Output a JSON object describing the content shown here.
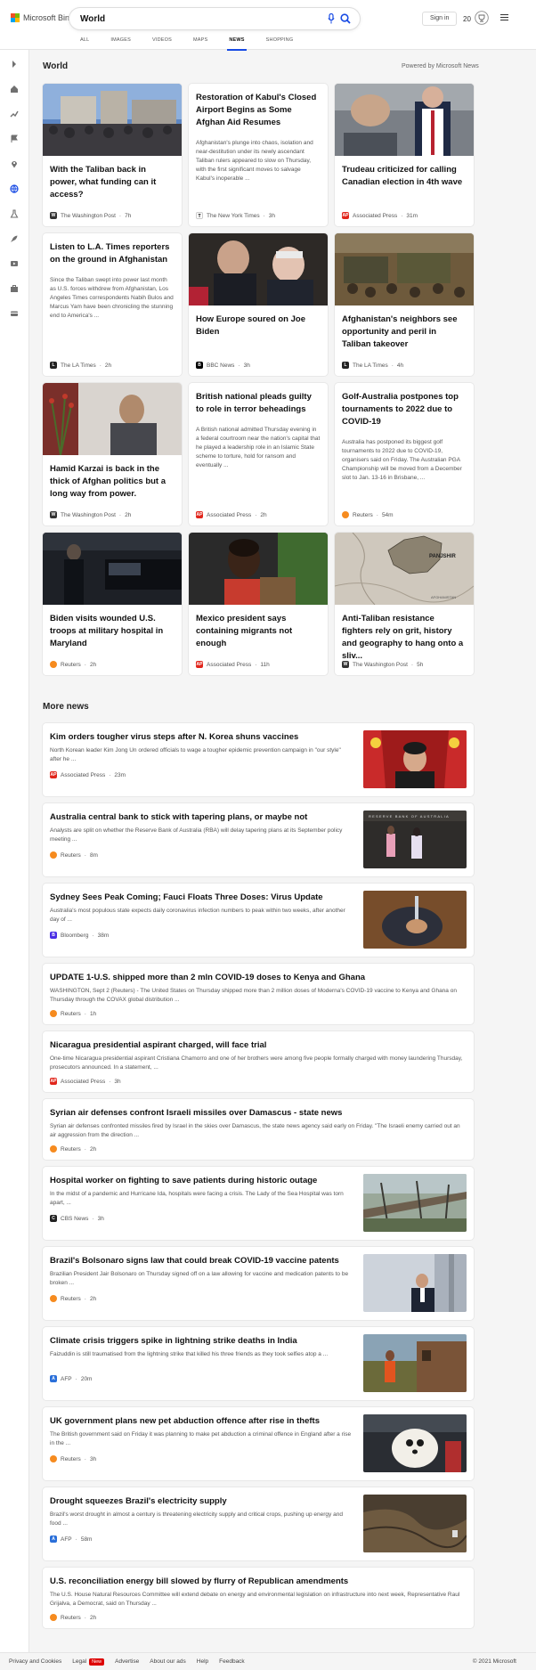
{
  "header": {
    "logo_text": "Microsoft Bing",
    "search_value": "World",
    "signin_label": "Sign in",
    "rewards_points": "20"
  },
  "scopes": [
    "ALL",
    "IMAGES",
    "VIDEOS",
    "MAPS",
    "NEWS",
    "SHOPPING"
  ],
  "active_scope": "NEWS",
  "section": {
    "title": "World",
    "powered_by": "Powered by Microsoft News"
  },
  "cards": [
    {
      "title": "With the Taliban back in power, what funding can it access?",
      "snippet": "",
      "source": "The Washington Post",
      "time": "7h"
    },
    {
      "title": "Restoration of Kabul's Closed Airport Begins as Some Afghan Aid Resumes",
      "snippet": "Afghanistan's plunge into chaos, isolation and near-destitution under its newly ascendant Taliban rulers appeared to slow on Thursday, with the first significant moves to salvage Kabul's inoperable ...",
      "source": "The New York Times",
      "time": "3h"
    },
    {
      "title": "Trudeau criticized for calling Canadian election in 4th wave",
      "snippet": "",
      "source": "Associated Press",
      "time": "31m"
    },
    {
      "title": "Listen to L.A. Times reporters on the ground in Afghanistan",
      "snippet": "Since the Taliban swept into power last month as U.S. forces withdrew from Afghanistan, Los Angeles Times correspondents Nabih Bulos and Marcus Yam have been chronicling the stunning end to America's ...",
      "source": "The LA Times",
      "time": "2h"
    },
    {
      "title": "How Europe soured on Joe Biden",
      "snippet": "",
      "source": "BBC News",
      "time": "3h"
    },
    {
      "title": "Afghanistan's neighbors see opportunity and peril in Taliban takeover",
      "snippet": "",
      "source": "The LA Times",
      "time": "4h"
    },
    {
      "title": "Hamid Karzai is back in the thick of Afghan politics but a long way from power.",
      "snippet": "",
      "source": "The Washington Post",
      "time": "2h"
    },
    {
      "title": "British national pleads guilty to role in terror beheadings",
      "snippet": "A British national admitted Thursday evening in a federal courtroom near the nation's capital that he played a leadership role in an Islamic State scheme to torture, hold for ransom and eventually ...",
      "source": "Associated Press",
      "time": "2h"
    },
    {
      "title": "Golf-Australia postpones top tournaments to 2022 due to COVID-19",
      "snippet": "Australia has postponed its biggest golf tournaments to 2022 due to COVID-19, organisers said on Friday. The Australian PGA Championship will be moved from a December slot to Jan. 13-16 in Brisbane, ...",
      "source": "Reuters",
      "time": "54m"
    },
    {
      "title": "Biden visits wounded U.S. troops at military hospital in Maryland",
      "snippet": "",
      "source": "Reuters",
      "time": "2h"
    },
    {
      "title": "Mexico president says containing migrants not enough",
      "snippet": "",
      "source": "Associated Press",
      "time": "11h"
    },
    {
      "title": "Anti-Taliban resistance fighters rely on grit, history and geography to hang onto a sliv...",
      "snippet": "",
      "source": "The Washington Post",
      "time": "5h"
    }
  ],
  "map_labels": {
    "region": "PANJSHIR",
    "country": "AFGHANISTAN"
  },
  "more_news": {
    "title": "More news",
    "items": [
      {
        "title": "Kim orders tougher virus steps after N. Korea shuns vaccines",
        "snippet": "North Korean leader Kim Jong Un ordered officials to wage a tougher epidemic prevention campaign in \"our style\" after he ...",
        "source": "Associated Press",
        "time": "23m"
      },
      {
        "title": "Australia central bank to stick with tapering plans, or maybe not",
        "snippet": "Analysts are split on whether the Reserve Bank of Australia (RBA) will delay tapering plans at its September policy meeting ...",
        "source": "Reuters",
        "time": "8m",
        "image_text": "RESERVE BANK OF AUSTRALIA"
      },
      {
        "title": "Sydney Sees Peak Coming; Fauci Floats Three Doses: Virus Update",
        "snippet": "Australia's most populous state expects daily coronavirus infection numbers to peak within two weeks, after another day of ...",
        "source": "Bloomberg",
        "time": "38m"
      },
      {
        "title": "UPDATE 1-U.S. shipped more than 2 mln COVID-19 doses to Kenya and Ghana",
        "snippet": "WASHINGTON, Sept 2 (Reuters) - The United States on Thursday shipped more than 2 million doses of Moderna's COVID-19 vaccine to Kenya and Ghana on Thursday through the COVAX global distribution ...",
        "source": "Reuters",
        "time": "1h"
      },
      {
        "title": "Nicaragua presidential aspirant charged, will face trial",
        "snippet": "One-time Nicaragua presidential aspirant Cristiana Chamorro and one of her brothers were among five people formally charged with money laundering Thursday, prosecutors announced. In a statement, ...",
        "source": "Associated Press",
        "time": "3h"
      },
      {
        "title": "Syrian air defenses confront Israeli missiles over Damascus - state news",
        "snippet": "Syrian air defenses confronted missiles fired by Israel in the skies over Damascus, the state news agency said early on Friday. \"The Israeli enemy carried out an air aggression from the direction ...",
        "source": "Reuters",
        "time": "2h"
      },
      {
        "title": "Hospital worker on fighting to save patients during historic outage",
        "snippet": "In the midst of a pandemic and Hurricane Ida, hospitals were facing a crisis. The Lady of the Sea Hospital was torn apart, ...",
        "source": "CBS News",
        "time": "3h"
      },
      {
        "title": "Brazil's Bolsonaro signs law that could break COVID-19 vaccine patents",
        "snippet": "Brazilian President Jair Bolsonaro on Thursday signed off on a law allowing for vaccine and medication patents to be broken ...",
        "source": "Reuters",
        "time": "2h"
      },
      {
        "title": "Climate crisis triggers spike in lightning strike deaths in India",
        "snippet": "Faizuddin is still traumatised from the lightning strike that killed his three friends as they took selfies atop a ...",
        "source": "AFP",
        "time": "20m"
      },
      {
        "title": "UK government plans new pet abduction offence after rise in thefts",
        "snippet": "The British government said on Friday it was planning to make pet abduction a criminal offence in England after a rise in the ...",
        "source": "Reuters",
        "time": "3h"
      },
      {
        "title": "Drought squeezes Brazil's electricity supply",
        "snippet": "Brazil's worst drought in almost a century is threatening electricity supply and critical crops, pushing up energy and food ...",
        "source": "AFP",
        "time": "58m"
      },
      {
        "title": "U.S. reconciliation energy bill slowed by flurry of Republican amendments",
        "snippet": "The U.S. House Natural Resources Committee will extend debate on energy and environmental legislation on infrastructure into next week, Representative Raul Grijalva, a Democrat, said on Thursday ...",
        "source": "Reuters",
        "time": "2h"
      }
    ]
  },
  "footer": {
    "privacy": "Privacy and Cookies",
    "legal": "Legal",
    "new_badge": "New",
    "advertise": "Advertise",
    "about_ads": "About our ads",
    "help": "Help",
    "feedback": "Feedback",
    "copyright": "© 2021 Microsoft"
  },
  "colors": {
    "accent": "#174ae4",
    "ms_red": "#f25022",
    "ms_green": "#7fba00",
    "ms_blue": "#00a4ef",
    "ms_yellow": "#ffb900",
    "ap_red": "#e1261c",
    "reuters_orange": "#f68b1f",
    "bloomberg_purple": "#4a2ee5",
    "afp_blue": "#2a6fd9"
  }
}
